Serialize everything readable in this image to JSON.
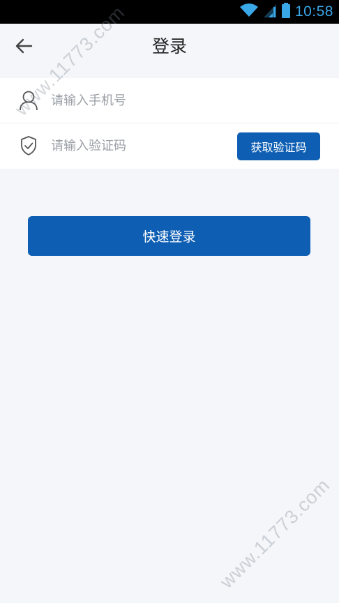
{
  "status_bar": {
    "time": "10:58",
    "icons": [
      "wifi-icon",
      "cellular-signal-icon",
      "battery-icon"
    ],
    "accent_color": "#3aa8e8"
  },
  "header": {
    "title": "登录",
    "back_icon": "arrow-left-icon"
  },
  "form": {
    "phone": {
      "icon": "user-icon",
      "placeholder": "请输入手机号",
      "value": ""
    },
    "code": {
      "icon": "shield-check-icon",
      "placeholder": "请输入验证码",
      "value": "",
      "button_label": "获取验证码"
    }
  },
  "login_button": {
    "label": "快速登录"
  },
  "watermark": {
    "text": "www.11773.com"
  },
  "colors": {
    "primary": "#0e5fb4",
    "background": "#f4f6f9",
    "placeholder": "#9a9ea5"
  }
}
